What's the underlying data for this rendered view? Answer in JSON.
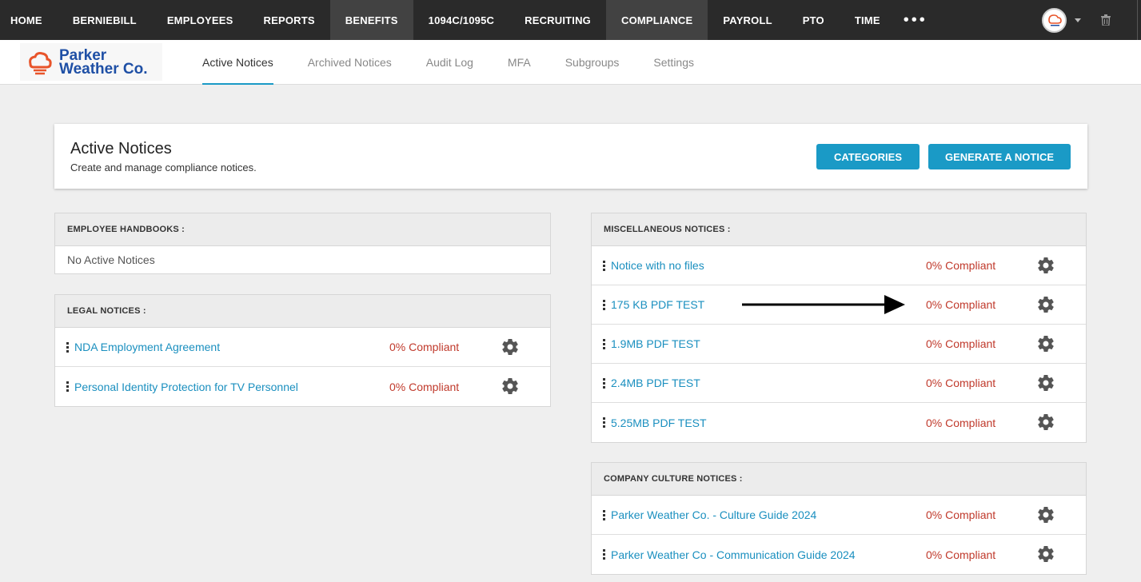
{
  "topnav": {
    "items": [
      "HOME",
      "BERNIEBILL",
      "EMPLOYEES",
      "REPORTS",
      "BENEFITS",
      "1094C/1095C",
      "RECRUITING",
      "COMPLIANCE",
      "PAYROLL",
      "PTO",
      "TIME"
    ],
    "more": "•••"
  },
  "logo": {
    "line1": "Parker",
    "line2": "Weather Co."
  },
  "tabs": [
    "Active Notices",
    "Archived Notices",
    "Audit Log",
    "MFA",
    "Subgroups",
    "Settings"
  ],
  "header": {
    "title": "Active Notices",
    "subtitle": "Create and manage compliance notices.",
    "categories_label": "CATEGORIES",
    "generate_label": "GENERATE A NOTICE"
  },
  "employee_handbooks": {
    "title": "EMPLOYEE HANDBOOKS :",
    "empty": "No Active Notices"
  },
  "legal_notices": {
    "title": "LEGAL NOTICES :",
    "items": [
      {
        "name": "NDA Employment Agreement",
        "status": "0% Compliant"
      },
      {
        "name": "Personal Identity Protection for TV Personnel",
        "status": "0% Compliant"
      }
    ]
  },
  "misc_notices": {
    "title": "MISCELLANEOUS NOTICES :",
    "items": [
      {
        "name": "Notice with no files",
        "status": "0% Compliant"
      },
      {
        "name": "175 KB PDF TEST",
        "status": "0% Compliant"
      },
      {
        "name": "1.9MB PDF TEST",
        "status": "0% Compliant"
      },
      {
        "name": "2.4MB PDF TEST",
        "status": "0% Compliant"
      },
      {
        "name": "5.25MB PDF TEST",
        "status": "0% Compliant"
      }
    ]
  },
  "culture_notices": {
    "title": "COMPANY CULTURE NOTICES :",
    "items": [
      {
        "name": "Parker Weather Co. - Culture Guide 2024",
        "status": "0% Compliant"
      },
      {
        "name": "Parker Weather Co - Communication Guide 2024",
        "status": "0% Compliant"
      }
    ]
  },
  "colors": {
    "accent": "#1a9ac6",
    "link": "#1a8fbf",
    "status": "#c0392b",
    "nav_bg": "#2a2a2a"
  }
}
